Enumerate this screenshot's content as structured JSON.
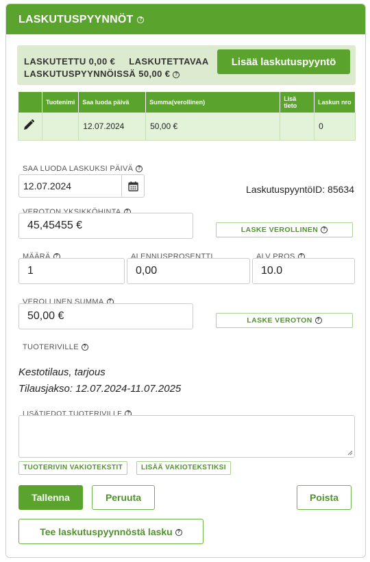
{
  "header": {
    "title": "LASKUTUSPYYNNÖT"
  },
  "summary": {
    "line1": "LASKUTETTU 0,00 €     LASKUTETTAVAA",
    "line2": "LASKUTUSPYYNNÖISSÄ 50,00 €",
    "add_button": "Lisää laskutuspyyntö"
  },
  "table": {
    "headers": [
      "",
      "Tuotenimi",
      "Saa luoda päivä",
      "Summa(verollinen)",
      "Lisä tieto",
      "Laskun nro"
    ],
    "rows": [
      {
        "tuotenimi": "",
        "paiva": "12.07.2024",
        "summa": "50,00 €",
        "lisatieto": "",
        "laskun_nro": "0"
      }
    ]
  },
  "form": {
    "date_label": "SAA LUODA LASKUKSI PÄIVÄ",
    "date_value": "12.07.2024",
    "request_id": "LaskutuspyyntöID: 85634",
    "unit_price_label": "VEROTON YKSIKKÖHINTA",
    "unit_price_value": "45,45455 €",
    "calc_gross_button": "LASKE VEROLLINEN",
    "qty_label": "MÄÄRÄ",
    "qty_value": "1",
    "discount_label": "ALENNUSPROSENTTI",
    "discount_value": "0,00",
    "vat_label": "ALV PROS",
    "vat_value": "10.0",
    "gross_label": "VEROLLINEN SUMMA",
    "gross_value": "50,00 €",
    "calc_net_button": "LASKE VEROTON",
    "product_row_label": "TUOTERIVILLE",
    "product_desc_1": "Kestotilaus, tarjous",
    "product_desc_2": "Tilausjakso: 12.07.2024-11.07.2025",
    "extra_info_label": "LISÄTIEDOT TUOTERIVILLE",
    "extra_info_value": "",
    "std_texts_button": "TUOTERIVIN VAKIOTEKSTIT",
    "add_std_text_button": "LISÄÄ VAKIOTEKSTIKSI"
  },
  "actions": {
    "save": "Tallenna",
    "cancel": "Peruuta",
    "delete": "Poista",
    "make_invoice": "Tee laskutuspyynnöstä lasku"
  },
  "colors": {
    "brand_green": "#5aa42e",
    "row_bg": "#e3f3d9",
    "summary_bg": "#dcebd0"
  },
  "icons": {
    "help": "question-circle-icon",
    "edit": "pencil-icon",
    "calendar": "calendar-icon"
  }
}
